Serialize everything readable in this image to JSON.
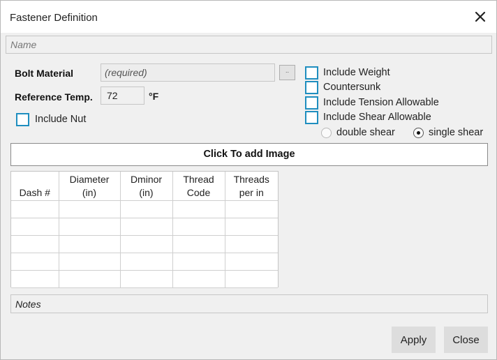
{
  "dialog": {
    "title": "Fastener Definition",
    "close_icon": "close-x-icon"
  },
  "name_field": {
    "placeholder": "Name",
    "value": ""
  },
  "bolt_material": {
    "label": "Bolt Material",
    "placeholder": "(required)",
    "value": "",
    "browse_label": ".."
  },
  "reference_temp": {
    "label": "Reference Temp.",
    "value": "72",
    "unit": "°F"
  },
  "include_nut": {
    "label": "Include Nut",
    "checked": false
  },
  "options": [
    {
      "id": "include-weight",
      "label": "Include Weight",
      "checked": false
    },
    {
      "id": "countersunk",
      "label": "Countersunk",
      "checked": false
    },
    {
      "id": "include-tension-allowable",
      "label": "Include Tension Allowable",
      "checked": false
    },
    {
      "id": "include-shear-allowable",
      "label": "Include Shear Allowable",
      "checked": false
    }
  ],
  "shear_mode": {
    "options": [
      {
        "id": "double-shear",
        "label": "double shear",
        "selected": false
      },
      {
        "id": "single-shear",
        "label": "single shear",
        "selected": true
      }
    ]
  },
  "image_button": {
    "label": "Click To add Image"
  },
  "dash_table": {
    "columns": [
      {
        "line1": "",
        "line2": "Dash #"
      },
      {
        "line1": "Diameter",
        "line2": "(in)"
      },
      {
        "line1": "Dminor",
        "line2": "(in)"
      },
      {
        "line1": "Thread",
        "line2": "Code"
      },
      {
        "line1": "Threads",
        "line2": "per in"
      }
    ],
    "rows": [
      [
        "",
        "",
        "",
        "",
        ""
      ],
      [
        "",
        "",
        "",
        "",
        ""
      ],
      [
        "",
        "",
        "",
        "",
        ""
      ],
      [
        "",
        "",
        "",
        "",
        ""
      ],
      [
        "",
        "",
        "",
        "",
        ""
      ]
    ]
  },
  "notes_field": {
    "placeholder": "Notes",
    "value": ""
  },
  "buttons": {
    "apply": "Apply",
    "close": "Close"
  },
  "colors": {
    "checkbox_border": "#1f8ebf",
    "dialog_bg": "#f0f0f0",
    "button_bg": "#dddddd"
  }
}
